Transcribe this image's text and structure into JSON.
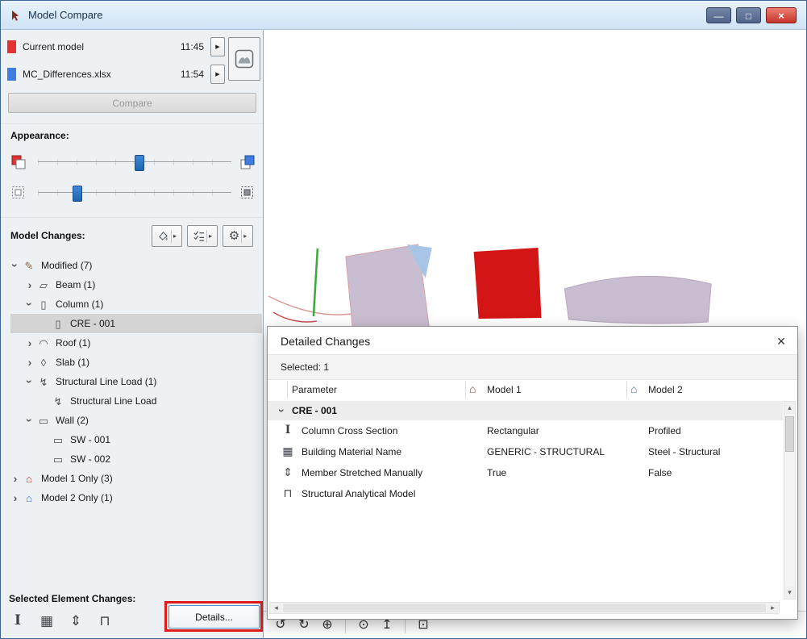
{
  "window": {
    "title": "Model Compare"
  },
  "models": {
    "rows": [
      {
        "name": "Current model",
        "time": "11:45",
        "color": "#e23232"
      },
      {
        "name": "MC_Differences.xlsx",
        "time": "11:54",
        "color": "#3f7de0"
      }
    ]
  },
  "compare": {
    "label": "Compare"
  },
  "appearance": {
    "label": "Appearance:",
    "sliders": [
      {
        "name": "highlight-intensity",
        "percent": 52
      },
      {
        "name": "context-fade",
        "percent": 20
      }
    ]
  },
  "model_changes": {
    "label": "Model Changes:",
    "buttons": [
      "highlight-style-options",
      "criteria-list-options",
      "settings-options"
    ],
    "tree": [
      {
        "label": "Modified (7)",
        "level": 0,
        "chevron": "expanded",
        "icon": "pencil-icon"
      },
      {
        "label": "Beam (1)",
        "level": 1,
        "chevron": "collapsed",
        "icon": "beam-icon"
      },
      {
        "label": "Column (1)",
        "level": 1,
        "chevron": "expanded",
        "icon": "column-icon"
      },
      {
        "label": "CRE - 001",
        "level": 2,
        "chevron": "none",
        "icon": "column-icon",
        "selected": true
      },
      {
        "label": "Roof (1)",
        "level": 1,
        "chevron": "collapsed",
        "icon": "roof-icon"
      },
      {
        "label": "Slab (1)",
        "level": 1,
        "chevron": "collapsed",
        "icon": "slab-icon"
      },
      {
        "label": "Structural Line Load (1)",
        "level": 1,
        "chevron": "expanded",
        "icon": "line-load-icon"
      },
      {
        "label": "Structural Line Load",
        "level": 2,
        "chevron": "none",
        "icon": "line-load-icon"
      },
      {
        "label": "Wall (2)",
        "level": 1,
        "chevron": "expanded",
        "icon": "wall-icon"
      },
      {
        "label": "SW - 001",
        "level": 2,
        "chevron": "none",
        "icon": "wall-icon"
      },
      {
        "label": "SW - 002",
        "level": 2,
        "chevron": "none",
        "icon": "wall-icon"
      },
      {
        "label": "Model 1 Only (3)",
        "level": 0,
        "chevron": "collapsed",
        "icon": "house-red-icon"
      },
      {
        "label": "Model 2 Only (1)",
        "level": 0,
        "chevron": "collapsed",
        "icon": "house-blue-icon"
      }
    ]
  },
  "selected_changes": {
    "label": "Selected Element Changes:",
    "icons": [
      "column-cross-section-icon",
      "building-material-icon",
      "member-stretched-icon",
      "structural-analytical-icon"
    ],
    "details_label": "Details..."
  },
  "dialog": {
    "title": "Detailed Changes",
    "selected": "Selected: 1",
    "columns": [
      "Parameter",
      "Model 1",
      "Model 2"
    ],
    "column_icons": [
      "",
      "house-red-icon",
      "house-blue-icon"
    ],
    "group": "CRE - 001",
    "rows": [
      {
        "icon": "column-cross-section-icon",
        "param": "Column Cross Section",
        "m1": "Rectangular",
        "m2": "Profiled"
      },
      {
        "icon": "building-material-icon",
        "param": "Building Material Name",
        "m1": "GENERIC - STRUCTURAL",
        "m2": "Steel - Structural"
      },
      {
        "icon": "member-stretched-icon",
        "param": "Member Stretched Manually",
        "m1": "True",
        "m2": "False"
      },
      {
        "icon": "structural-analytical-icon",
        "param": "Structural Analytical Model",
        "m1": "",
        "m2": ""
      }
    ]
  },
  "viewport": {
    "toolbar": [
      {
        "icon": "undo-view-icon"
      },
      {
        "icon": "redo-view-icon"
      },
      {
        "icon": "zoom-in-icon"
      },
      {
        "sep": true
      },
      {
        "icon": "orbit-icon"
      },
      {
        "icon": "fit-view-icon"
      },
      {
        "sep": true
      },
      {
        "icon": "zoom-selection-icon"
      }
    ]
  },
  "colors": {
    "model1_accent": "#e23232",
    "model2_accent": "#3f7de0",
    "selection_bg": "#d4d4d4",
    "annotation_red": "#e01b1b",
    "shape_lavender": "#c9bed1",
    "shape_red": "#d31515",
    "shape_green": "#3aa93a",
    "shape_blue_patch": "#a8c5e8"
  }
}
